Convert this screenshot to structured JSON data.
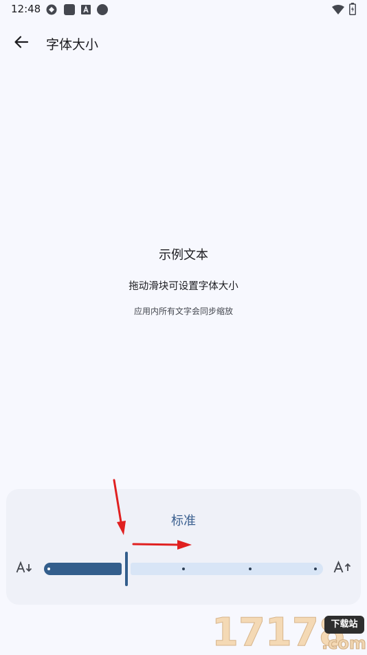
{
  "status_bar": {
    "time": "12:48",
    "left_icons": [
      "sync-icon",
      "square-app-icon",
      "a-app-icon",
      "circle-app-icon"
    ],
    "right_icons": [
      "wifi-icon",
      "battery-icon"
    ]
  },
  "app_bar": {
    "back_icon": "arrow-left-icon",
    "title": "字体大小"
  },
  "preview": {
    "title": "示例文本",
    "body": "拖动滑块可设置字体大小",
    "caption": "应用内所有文字会同步缩放"
  },
  "font_panel": {
    "level_label": "标准",
    "decrease_icon": "text-decrease-icon",
    "increase_icon": "text-increase-icon",
    "slider": {
      "steps": 5,
      "selected_index": 1,
      "value_fraction": 0.25
    }
  },
  "colors": {
    "background": "#f7f8fe",
    "panel": "#eff1f8",
    "accent": "#335e8c",
    "track_inactive": "#d8e5f6",
    "annotation_arrow": "#e02020"
  },
  "watermark": {
    "digits": "17178",
    "badge": "下载站",
    "suffix": ".com"
  }
}
